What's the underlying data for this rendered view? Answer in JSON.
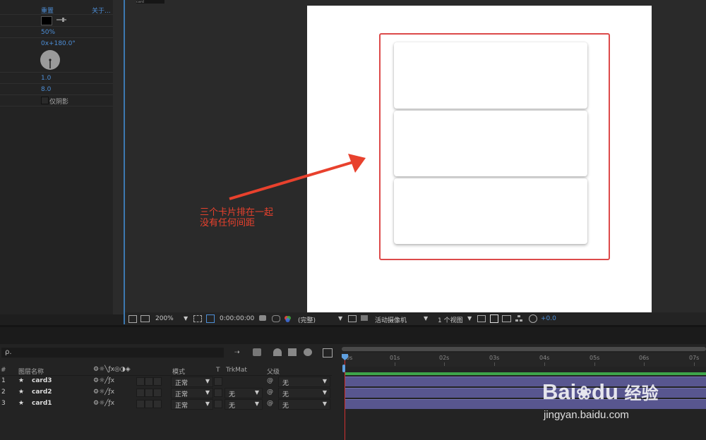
{
  "effect_panel": {
    "header_reset": "重置",
    "header_about": "关于...",
    "opacity": "50%",
    "direction": "0x+180.0°",
    "distance": "1.0",
    "softness": "8.0",
    "shadow_only_label": "仅阴影"
  },
  "viewer": {
    "tab_label": "card",
    "zoom": "200%",
    "timecode": "0:00:00:00",
    "resolution": "(完整)",
    "camera": "活动摄像机",
    "views": "1 个视图",
    "exposure": "+0.0"
  },
  "annotation": {
    "line1": "三个卡片排在一起",
    "line2": "没有任何间距",
    "color": "#e8412d"
  },
  "timeline": {
    "search_placeholder": "ρ.",
    "columns": {
      "num": "#",
      "layer_name": "图层名称",
      "mode": "模式",
      "t": "T",
      "trkmat": "TrkMat",
      "parent": "父级"
    },
    "layers": [
      {
        "num": "1",
        "name": "card3",
        "mode": "正常",
        "trkmat": "",
        "parent": "无"
      },
      {
        "num": "2",
        "name": "card2",
        "mode": "正常",
        "trkmat": "无",
        "parent": "无"
      },
      {
        "num": "3",
        "name": "card1",
        "mode": "正常",
        "trkmat": "无",
        "parent": "无"
      }
    ],
    "ruler": [
      "0s",
      "01s",
      "02s",
      "03s",
      "04s",
      "05s",
      "06s",
      "07s"
    ]
  },
  "watermark": {
    "brand": "Bai",
    "brand2": "du",
    "cn": "经验",
    "url": "jingyan.baidu.com"
  }
}
